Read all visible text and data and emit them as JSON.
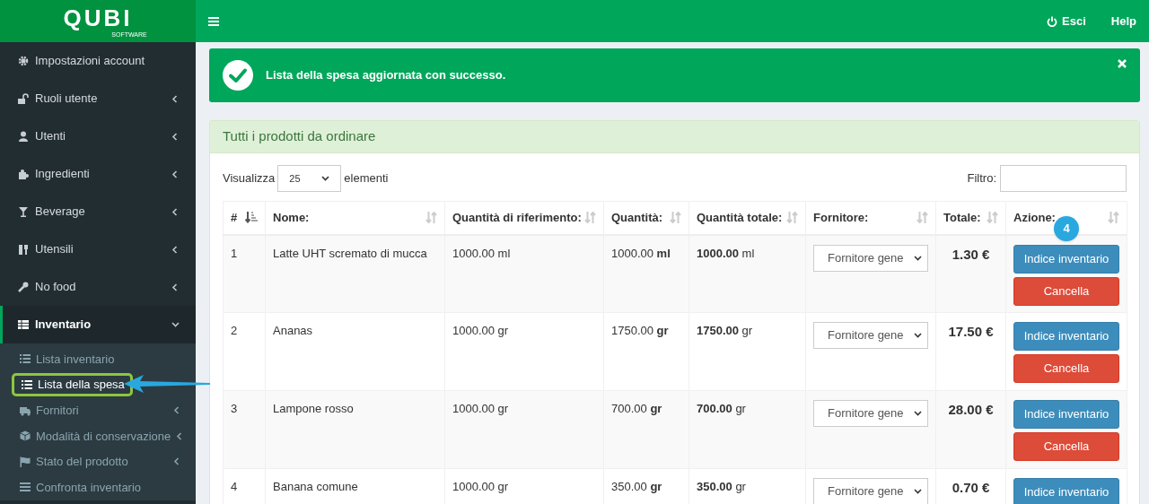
{
  "logo": {
    "text": "QUBI",
    "subtitle": "SOFTWARE"
  },
  "topbar": {
    "logout": "Esci",
    "help": "Help"
  },
  "sidebar": {
    "items": [
      {
        "label": "Impostazioni account",
        "kind": "link",
        "expanded": false
      },
      {
        "label": "Ruoli utente",
        "kind": "submenu",
        "expanded": false
      },
      {
        "label": "Utenti",
        "kind": "submenu",
        "expanded": false
      },
      {
        "label": "Ingredienti",
        "kind": "submenu",
        "expanded": false
      },
      {
        "label": "Beverage",
        "kind": "submenu",
        "expanded": false
      },
      {
        "label": "Utensili",
        "kind": "submenu",
        "expanded": false
      },
      {
        "label": "No food",
        "kind": "submenu",
        "expanded": false
      },
      {
        "label": "Inventario",
        "kind": "submenu",
        "expanded": true,
        "children": [
          {
            "label": "Lista inventario",
            "kind": "link",
            "selected": false
          },
          {
            "label": "Lista della spesa",
            "kind": "link",
            "selected": true
          },
          {
            "label": "Fornitori",
            "kind": "submenu",
            "selected": false
          },
          {
            "label": "Modalità di conservazione",
            "kind": "submenu",
            "selected": false
          },
          {
            "label": "Stato del prodotto",
            "kind": "submenu",
            "selected": false
          },
          {
            "label": "Confronta inventario",
            "kind": "link",
            "selected": false
          }
        ]
      }
    ]
  },
  "alert": {
    "message": "Lista della spesa aggiornata con successo."
  },
  "panel": {
    "title": "Tutti i prodotti da ordinare",
    "show_label": "Visualizza",
    "page_size": "25",
    "show_suffix": "elementi",
    "filter_label": "Filtro:"
  },
  "table": {
    "columns": [
      {
        "label": "#",
        "sorted": true
      },
      {
        "label": "Nome:",
        "sorted": false
      },
      {
        "label": "Quantità di riferimento:",
        "sorted": false
      },
      {
        "label": "Quantità:",
        "sorted": false
      },
      {
        "label": "Quantità totale:",
        "sorted": false
      },
      {
        "label": "Fornitore:",
        "sorted": false
      },
      {
        "label": "Totale:",
        "sorted": false
      },
      {
        "label": "Azione:",
        "sorted": false
      }
    ],
    "rows": [
      {
        "num": "1",
        "name": "Latte UHT scremato di mucca",
        "reference_qty": "1000.00 ml",
        "qty": "1000.00 **ml**",
        "total_qty": "**1000.00** ml",
        "supplier": "Fornitore gene",
        "total": "1.30 €",
        "actions": [
          "Indice inventario",
          "Cancella"
        ]
      },
      {
        "num": "2",
        "name": "Ananas",
        "reference_qty": "1000.00 gr",
        "qty": "1750.00 **gr**",
        "total_qty": "**1750.00** gr",
        "supplier": "Fornitore gene",
        "total": "17.50 €",
        "actions": [
          "Indice inventario",
          "Cancella"
        ]
      },
      {
        "num": "3",
        "name": "Lampone rosso",
        "reference_qty": "1000.00 gr",
        "qty": "700.00 **gr**",
        "total_qty": "**700.00** gr",
        "supplier": "Fornitore gene",
        "total": "28.00 €",
        "actions": [
          "Indice inventario",
          "Cancella"
        ]
      },
      {
        "num": "4",
        "name": "Banana comune",
        "reference_qty": "1000.00 gr",
        "qty": "350.00 **gr**",
        "total_qty": "**350.00** gr",
        "supplier": "Fornitore gene",
        "total": "0.70 €",
        "actions": [
          "Indice inventario"
        ]
      }
    ]
  },
  "callout": {
    "badge": "4"
  }
}
